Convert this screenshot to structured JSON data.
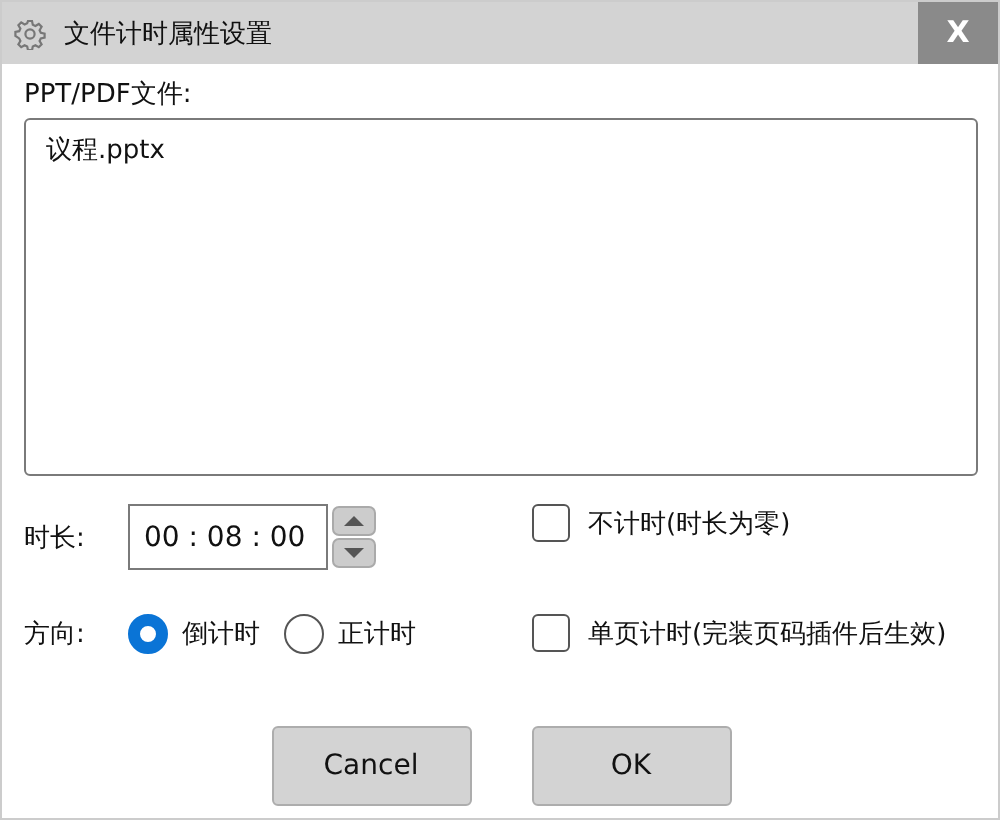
{
  "window": {
    "title": "文件计时属性设置",
    "close": "X"
  },
  "file_label": "PPT/PDF文件:",
  "file_list": {
    "value": "议程.pptx"
  },
  "duration": {
    "label": "时长:",
    "value": "00 : 08 : 00"
  },
  "direction": {
    "label": "方向:",
    "options": [
      {
        "label": "倒计时",
        "selected": true
      },
      {
        "label": "正计时",
        "selected": false
      }
    ]
  },
  "checkboxes": [
    {
      "label": "不计时(时长为零)",
      "checked": false
    },
    {
      "label": "单页计时(完装页码插件后生效)",
      "checked": false
    }
  ],
  "buttons": [
    "Cancel",
    "OK"
  ]
}
